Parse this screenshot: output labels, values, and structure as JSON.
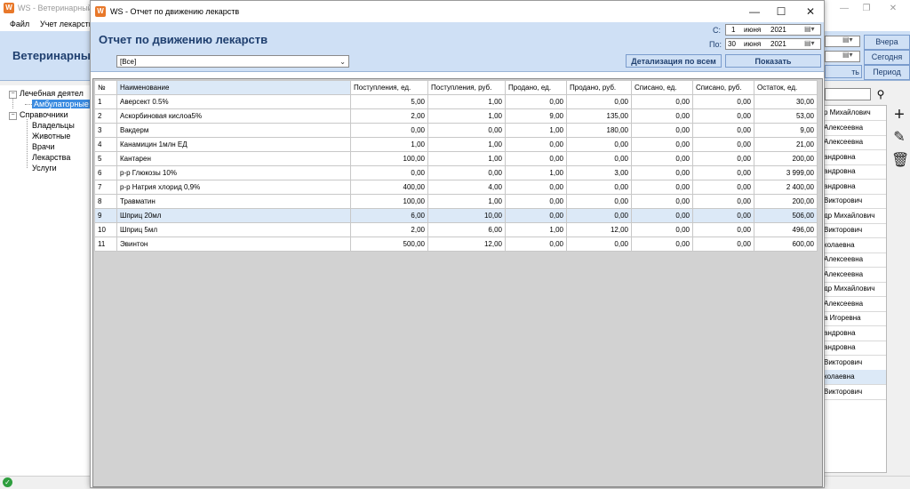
{
  "background": {
    "window_title": "WS - Ветеринарный",
    "menu": [
      "Файл",
      "Учет лекарств"
    ],
    "header_title": "Ветеринарны",
    "tree": [
      {
        "label": "Лечебная деятел",
        "level": 0
      },
      {
        "label": "Амбулаторные",
        "level": 1,
        "selected": true
      },
      {
        "label": "Справочники",
        "level": 0
      },
      {
        "label": "Владельцы",
        "level": 1
      },
      {
        "label": "Животные",
        "level": 1
      },
      {
        "label": "Врачи",
        "level": 1
      },
      {
        "label": "Лекарства",
        "level": 1
      },
      {
        "label": "Услуги",
        "level": 1
      }
    ],
    "right_buttons": {
      "yesterday": "Вчера",
      "today": "Сегодня",
      "period": "Период",
      "show_partial": "ть"
    },
    "right_list": [
      "р  Михайлович",
      "Алексеевна",
      "Алексеевна",
      "андровна",
      "андровна",
      "андровна",
      "Викторович",
      "др  Михайлович",
      "Викторович",
      "колаевна",
      "Алексеевна",
      "Алексеевна",
      "др  Михайлович",
      "Алексеевна",
      "а  Игоревна",
      "андровна",
      "андровна",
      "Викторович",
      "колаевна",
      "Викторович"
    ]
  },
  "dialog": {
    "title": "WS - Отчет по движению лекарств",
    "heading": "Отчет по движению лекарств",
    "filter_value": "[Все]",
    "date_from_label": "С:",
    "date_to_label": "По:",
    "date_from": {
      "day": "1",
      "month": "июня",
      "year": "2021"
    },
    "date_to": {
      "day": "30",
      "month": "июня",
      "year": "2021"
    },
    "detail_button": "Детализация по всем",
    "show_button": "Показать"
  },
  "table": {
    "columns": [
      "№",
      "Наименование",
      "Поступления, ед.",
      "Поступления, руб.",
      "Продано, ед.",
      "Продано, руб.",
      "Списано, ед.",
      "Списано, руб.",
      "Остаток, ед."
    ],
    "rows": [
      [
        "1",
        "Аверсект 0.5%",
        "5,00",
        "1,00",
        "0,00",
        "0,00",
        "0,00",
        "0,00",
        "30,00"
      ],
      [
        "2",
        "Аскорбиновая кислоа5%",
        "2,00",
        "1,00",
        "9,00",
        "135,00",
        "0,00",
        "0,00",
        "53,00"
      ],
      [
        "3",
        "Вакдерм",
        "0,00",
        "0,00",
        "1,00",
        "180,00",
        "0,00",
        "0,00",
        "9,00"
      ],
      [
        "4",
        "Канамицин 1млн ЕД",
        "1,00",
        "1,00",
        "0,00",
        "0,00",
        "0,00",
        "0,00",
        "21,00"
      ],
      [
        "5",
        "Кантарен",
        "100,00",
        "1,00",
        "0,00",
        "0,00",
        "0,00",
        "0,00",
        "200,00"
      ],
      [
        "6",
        "р-р Глюкозы 10%",
        "0,00",
        "0,00",
        "1,00",
        "3,00",
        "0,00",
        "0,00",
        "3 999,00"
      ],
      [
        "7",
        "р-р Натрия хлорид 0,9%",
        "400,00",
        "4,00",
        "0,00",
        "0,00",
        "0,00",
        "0,00",
        "2 400,00"
      ],
      [
        "8",
        "Травматин",
        "100,00",
        "1,00",
        "0,00",
        "0,00",
        "0,00",
        "0,00",
        "200,00"
      ],
      [
        "9",
        "Шприц 20мл",
        "6,00",
        "10,00",
        "0,00",
        "0,00",
        "0,00",
        "0,00",
        "506,00"
      ],
      [
        "10",
        "Шприц 5мл",
        "2,00",
        "6,00",
        "1,00",
        "12,00",
        "0,00",
        "0,00",
        "496,00"
      ],
      [
        "11",
        "Эвинтон",
        "500,00",
        "12,00",
        "0,00",
        "0,00",
        "0,00",
        "0,00",
        "600,00"
      ]
    ],
    "highlighted_row": 8
  }
}
